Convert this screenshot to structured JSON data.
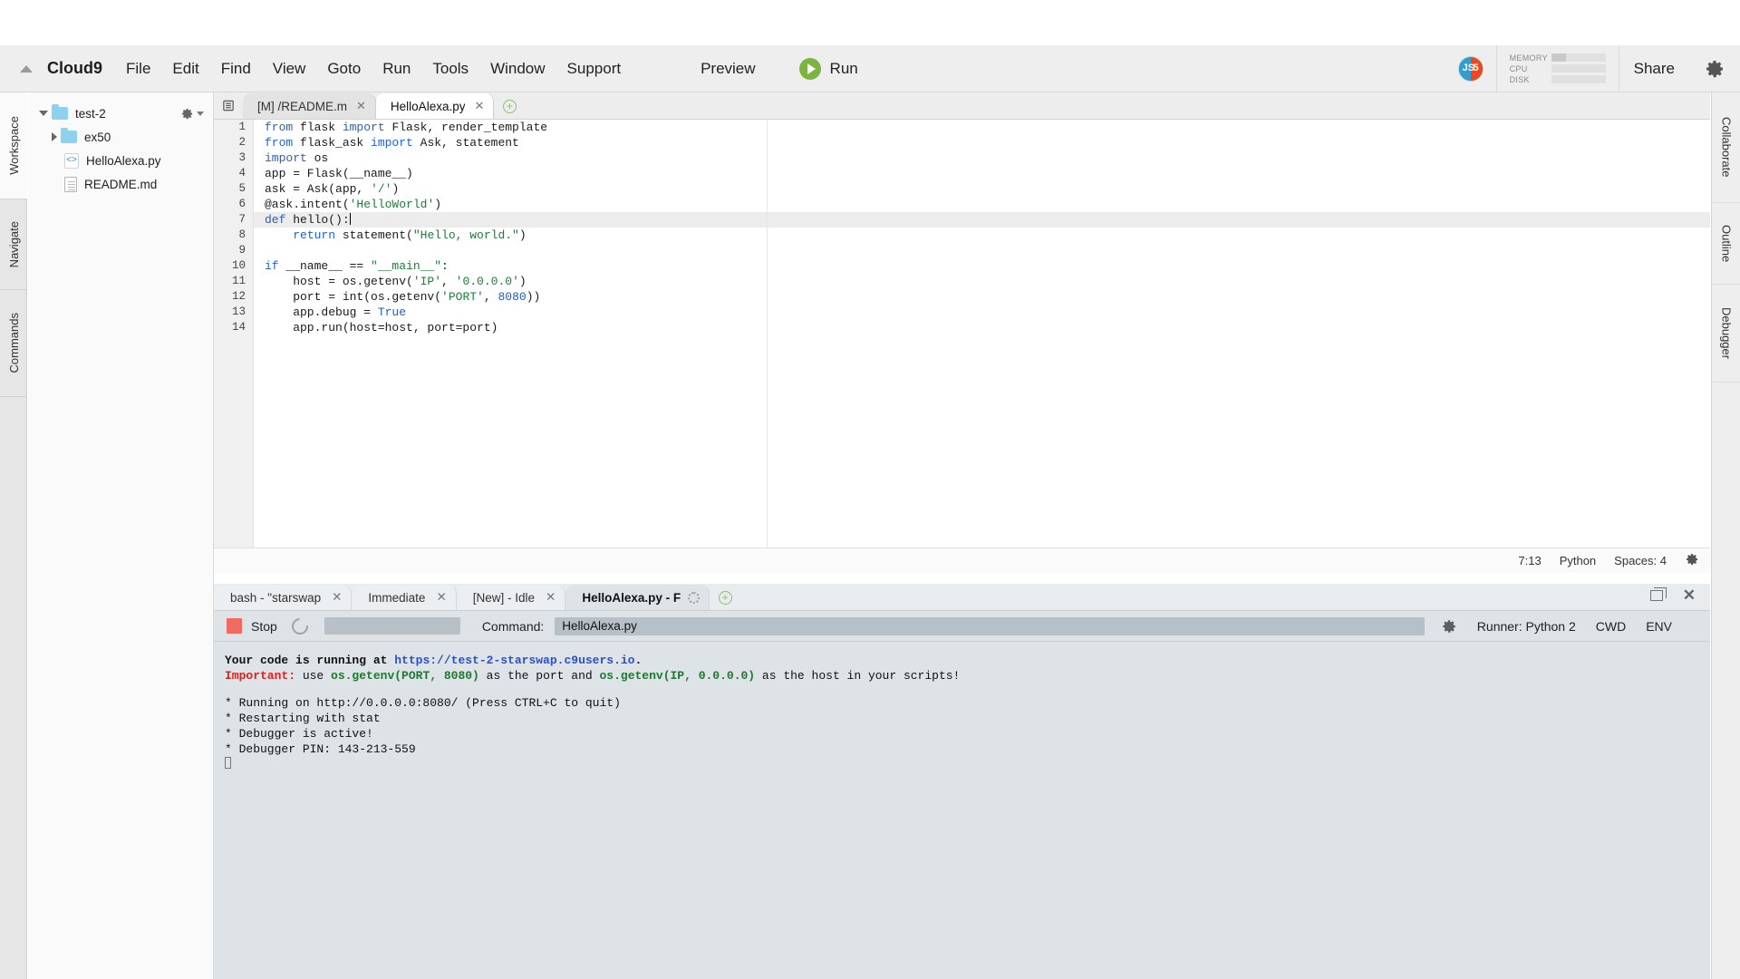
{
  "app": {
    "brand": "Cloud9"
  },
  "menubar": {
    "items": [
      "File",
      "Edit",
      "Find",
      "View",
      "Goto",
      "Run",
      "Tools",
      "Window",
      "Support"
    ],
    "preview_label": "Preview",
    "run_label": "Run",
    "share_label": "Share",
    "meters": [
      {
        "label": "MEMORY",
        "fill_pct": 28
      },
      {
        "label": "CPU",
        "fill_pct": 0
      },
      {
        "label": "DISK",
        "fill_pct": 0
      }
    ],
    "avatar_left_text": "JS",
    "avatar_right_text": "5"
  },
  "rail_left": {
    "items": [
      "Workspace",
      "Navigate",
      "Commands"
    ],
    "active": "Workspace"
  },
  "rail_right": {
    "items": [
      "Collaborate",
      "Outline",
      "Debugger"
    ]
  },
  "filetree": {
    "root": {
      "name": "test-2",
      "expanded": true
    },
    "children": [
      {
        "name": "ex50",
        "type": "folder",
        "expanded": false
      },
      {
        "name": "HelloAlexa.py",
        "type": "code"
      },
      {
        "name": "README.md",
        "type": "doc"
      }
    ]
  },
  "editor": {
    "tabs": [
      {
        "label": "[M] /README.m",
        "active": false
      },
      {
        "label": "HelloAlexa.py",
        "active": true
      }
    ],
    "filename": "HelloAlexa.py",
    "active_line": 7,
    "lines": [
      {
        "n": 1,
        "tokens": [
          {
            "t": "from ",
            "c": "k"
          },
          {
            "t": "flask ",
            "c": ""
          },
          {
            "t": "import ",
            "c": "k"
          },
          {
            "t": "Flask, render_template",
            "c": ""
          }
        ]
      },
      {
        "n": 2,
        "tokens": [
          {
            "t": "from ",
            "c": "k"
          },
          {
            "t": "flask_ask ",
            "c": ""
          },
          {
            "t": "import ",
            "c": "k"
          },
          {
            "t": "Ask, statement",
            "c": ""
          }
        ]
      },
      {
        "n": 3,
        "tokens": [
          {
            "t": "import ",
            "c": "k"
          },
          {
            "t": "os",
            "c": ""
          }
        ]
      },
      {
        "n": 4,
        "tokens": [
          {
            "t": "app = Flask(__name__)",
            "c": ""
          }
        ]
      },
      {
        "n": 5,
        "tokens": [
          {
            "t": "ask = Ask(app, ",
            "c": ""
          },
          {
            "t": "'/'",
            "c": "s"
          },
          {
            "t": ")",
            "c": ""
          }
        ]
      },
      {
        "n": 6,
        "tokens": [
          {
            "t": "@ask.intent(",
            "c": ""
          },
          {
            "t": "'HelloWorld'",
            "c": "s"
          },
          {
            "t": ")",
            "c": ""
          }
        ]
      },
      {
        "n": 7,
        "tokens": [
          {
            "t": "def ",
            "c": "k"
          },
          {
            "t": "hello():",
            "c": ""
          }
        ]
      },
      {
        "n": 8,
        "tokens": [
          {
            "t": "    ",
            "c": ""
          },
          {
            "t": "return ",
            "c": "k"
          },
          {
            "t": "statement(",
            "c": ""
          },
          {
            "t": "\"Hello, world.\"",
            "c": "s"
          },
          {
            "t": ")",
            "c": ""
          }
        ]
      },
      {
        "n": 9,
        "tokens": [
          {
            "t": "",
            "c": ""
          }
        ]
      },
      {
        "n": 10,
        "tokens": [
          {
            "t": "if ",
            "c": "k"
          },
          {
            "t": "__name__ == ",
            "c": ""
          },
          {
            "t": "\"__main__\"",
            "c": "s"
          },
          {
            "t": ":",
            "c": ""
          }
        ]
      },
      {
        "n": 11,
        "tokens": [
          {
            "t": "    host = os.getenv(",
            "c": ""
          },
          {
            "t": "'IP'",
            "c": "s"
          },
          {
            "t": ", ",
            "c": ""
          },
          {
            "t": "'0.0.0.0'",
            "c": "s"
          },
          {
            "t": ")",
            "c": ""
          }
        ]
      },
      {
        "n": 12,
        "tokens": [
          {
            "t": "    port = int(os.getenv(",
            "c": ""
          },
          {
            "t": "'PORT'",
            "c": "s"
          },
          {
            "t": ", ",
            "c": ""
          },
          {
            "t": "8080",
            "c": "n"
          },
          {
            "t": "))",
            "c": ""
          }
        ]
      },
      {
        "n": 13,
        "tokens": [
          {
            "t": "    app.debug = ",
            "c": ""
          },
          {
            "t": "True",
            "c": "k"
          }
        ]
      },
      {
        "n": 14,
        "tokens": [
          {
            "t": "    app.run(host=host, port=port)",
            "c": ""
          }
        ]
      }
    ],
    "status": {
      "cursor": "7:13",
      "language": "Python",
      "indent": "Spaces: 4"
    }
  },
  "console": {
    "tabs": [
      {
        "label": "bash - \"starswap",
        "active": false,
        "closable": true
      },
      {
        "label": "Immediate",
        "active": false,
        "closable": true
      },
      {
        "label": "[New] - Idle",
        "active": false,
        "closable": true
      },
      {
        "label": "HelloAlexa.py - F",
        "active": true,
        "closable": false,
        "spinner": true
      }
    ],
    "runbar": {
      "stop_label": "Stop",
      "command_label": "Command:",
      "command_value": "HelloAlexa.py",
      "command_placeholder": "",
      "runner_label": "Runner: Python 2",
      "cwd_label": "CWD",
      "env_label": "ENV"
    },
    "output": {
      "line1_prefix": "Your code is running at ",
      "line1_url": "https://test-2-starswap.c9users.io",
      "line1_suffix": ".",
      "line2_important": "Important:",
      "line2_a": " use ",
      "line2_code1": "os.getenv(PORT, 8080)",
      "line2_b": " as the port and ",
      "line2_code2": "os.getenv(IP, 0.0.0.0)",
      "line2_c": " as the host in your scripts!",
      "flask_lines": [
        " * Running on http://0.0.0.0:8080/ (Press CTRL+C to quit)",
        " * Restarting with stat",
        " * Debugger is active!",
        " * Debugger PIN: 143-213-559"
      ]
    }
  },
  "colors": {
    "accent_green": "#7cb342",
    "stop_red": "#ef6a61",
    "folder_blue": "#8ed0ef",
    "link_blue": "#2a4fd0"
  }
}
